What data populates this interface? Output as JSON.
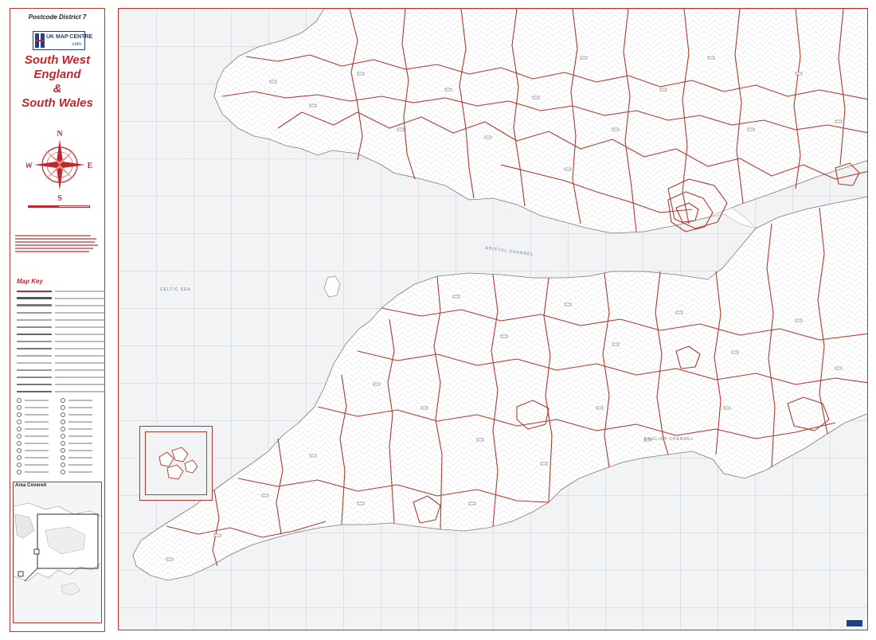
{
  "header": {
    "district_label": "Postcode District 7",
    "logo_text": "UK MAP CENTRE",
    "logo_suffix": ".com"
  },
  "title": {
    "line1": "South West",
    "line2": "England",
    "line3": "&",
    "line4": "South Wales"
  },
  "compass": {
    "north": "N",
    "south": "S",
    "east": "E",
    "west": "W"
  },
  "key": {
    "title": "Map Key"
  },
  "area_covered": {
    "label": "Area Covered"
  },
  "sea_labels": {
    "celtic_sea": "CELTIC SEA",
    "bristol_channel": "BRISTOL CHANNEL",
    "english_channel": "ENGLISH CHANNEL"
  },
  "colors": {
    "boundary": "#b03a2e",
    "title": "#c0282d",
    "land": "#ffffff",
    "sea": "#f2f3f5",
    "logo": "#1e3f8a"
  }
}
